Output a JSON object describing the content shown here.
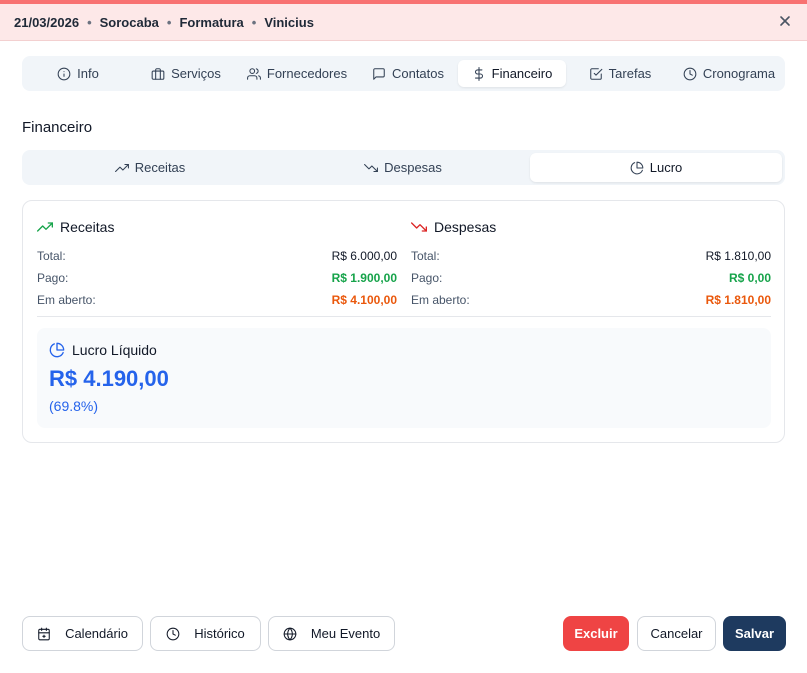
{
  "header": {
    "date": "21/03/2026",
    "city": "Sorocaba",
    "event_type": "Formatura",
    "client": "Vinicius",
    "separator": "•",
    "close_label": "×"
  },
  "tabs": [
    {
      "label": "Info",
      "icon": "info-icon"
    },
    {
      "label": "Serviços",
      "icon": "briefcase-icon"
    },
    {
      "label": "Fornecedores",
      "icon": "users-icon"
    },
    {
      "label": "Contatos",
      "icon": "message-square-icon"
    },
    {
      "label": "Financeiro",
      "icon": "dollar-icon",
      "active": true
    },
    {
      "label": "Tarefas",
      "icon": "check-square-icon"
    },
    {
      "label": "Cronograma",
      "icon": "clock-icon"
    }
  ],
  "section_title": "Financeiro",
  "subtabs": [
    {
      "label": "Receitas",
      "icon": "trending-up-icon"
    },
    {
      "label": "Despesas",
      "icon": "trending-down-icon"
    },
    {
      "label": "Lucro",
      "icon": "pie-chart-icon",
      "active": true
    }
  ],
  "receitas": {
    "title": "Receitas",
    "rows": [
      {
        "label": "Total:",
        "value": "R$ 6.000,00"
      },
      {
        "label": "Pago:",
        "value": "R$ 1.900,00"
      },
      {
        "label": "Em aberto:",
        "value": "R$ 4.100,00"
      }
    ]
  },
  "despesas": {
    "title": "Despesas",
    "rows": [
      {
        "label": "Total:",
        "value": "R$ 1.810,00"
      },
      {
        "label": "Pago:",
        "value": "R$ 0,00"
      },
      {
        "label": "Em aberto:",
        "value": "R$ 1.810,00"
      }
    ]
  },
  "lucro": {
    "title": "Lucro Líquido",
    "value": "R$ 4.190,00",
    "percent": "(69.8%)"
  },
  "footer": {
    "calendario": "Calendário",
    "historico": "Histórico",
    "meu_evento": "Meu Evento",
    "excluir": "Excluir",
    "cancelar": "Cancelar",
    "salvar": "Salvar"
  },
  "colors": {
    "accent_red": "#ef4444",
    "header_bg": "#fde8e8",
    "primary_navy": "#1e3a5f",
    "profit_blue": "#2563eb",
    "paid_green": "#16a34a",
    "open_orange": "#ea580c"
  }
}
